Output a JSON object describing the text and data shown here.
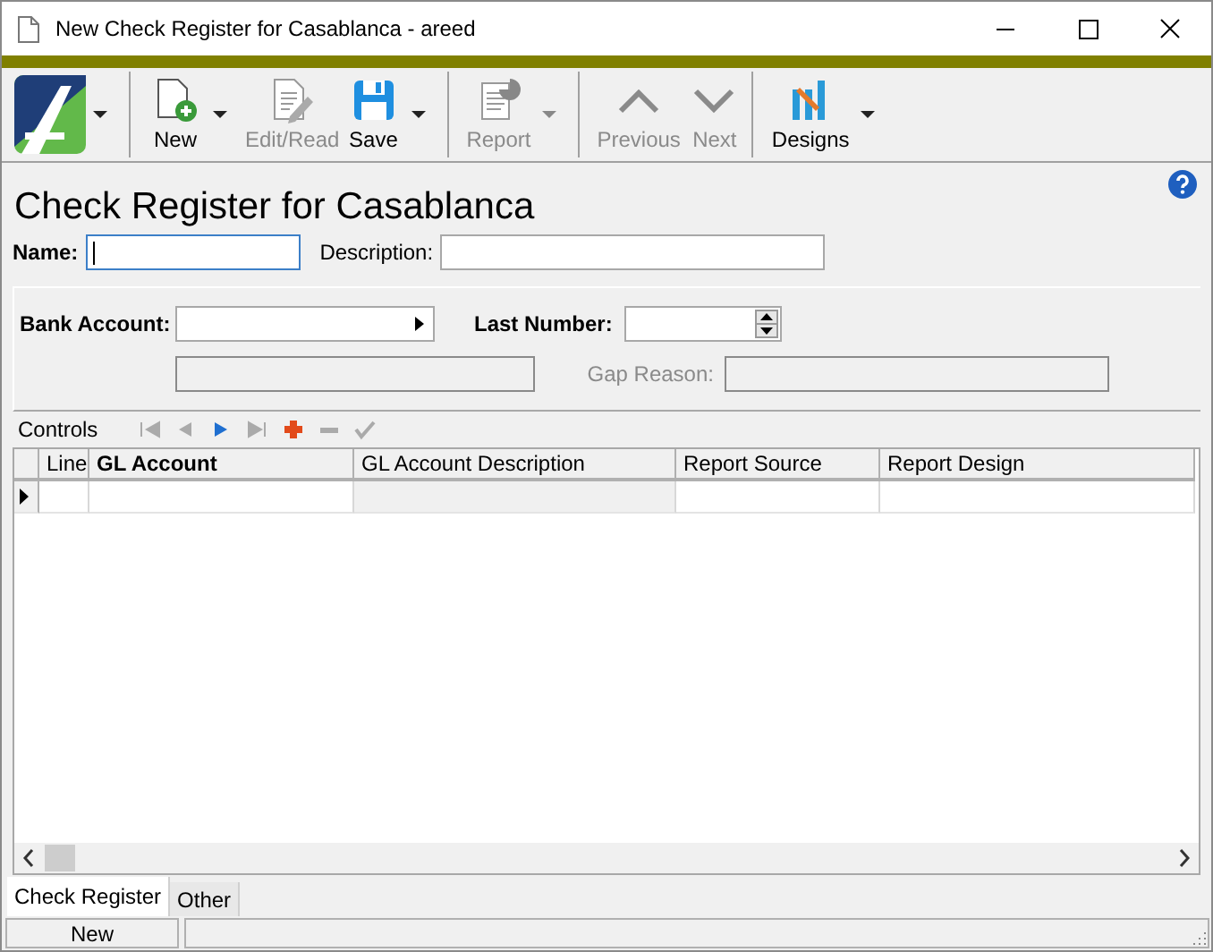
{
  "window": {
    "title": "New Check Register for Casablanca - areed"
  },
  "toolbar": [
    {
      "kind": "logo",
      "dropdown": true
    },
    {
      "kind": "new",
      "label": "New",
      "disabled": false,
      "dropdown": true
    },
    {
      "kind": "edit",
      "label": "Edit/Read",
      "disabled": true,
      "dropdown": false
    },
    {
      "kind": "save",
      "label": "Save",
      "disabled": false,
      "dropdown": true
    },
    {
      "kind": "report",
      "label": "Report",
      "disabled": true,
      "dropdown": true
    },
    {
      "kind": "previous",
      "label": "Previous",
      "disabled": true,
      "dropdown": false
    },
    {
      "kind": "next",
      "label": "Next",
      "disabled": true,
      "dropdown": false
    },
    {
      "kind": "designs",
      "label": "Designs",
      "disabled": false,
      "dropdown": true
    }
  ],
  "heading": "Check Register for Casablanca",
  "name_field": {
    "label": "Name:",
    "focused": true
  },
  "description_field": {
    "label": "Description:"
  },
  "bank_account": {
    "label": "Bank Account:"
  },
  "last_number": {
    "label": "Last Number:"
  },
  "gap_reason": {
    "label": "Gap Reason:",
    "disabled": true
  },
  "navigator": {
    "label": "Controls",
    "buttons": [
      {
        "kind": "first",
        "disabled": true
      },
      {
        "kind": "prev",
        "disabled": true
      },
      {
        "kind": "next",
        "disabled": false
      },
      {
        "kind": "last",
        "disabled": true
      },
      {
        "kind": "add",
        "disabled": false
      },
      {
        "kind": "remove",
        "disabled": true
      },
      {
        "kind": "confirm",
        "disabled": true
      }
    ]
  },
  "table": {
    "columns": [
      {
        "label": "Line",
        "required": false,
        "readonly": false
      },
      {
        "label": "GL Account",
        "required": true,
        "readonly": false
      },
      {
        "label": "GL Account Description",
        "required": false,
        "readonly": true
      },
      {
        "label": "Report Source",
        "required": false,
        "readonly": false
      },
      {
        "label": "Report Design",
        "required": false,
        "readonly": false
      }
    ],
    "rows": [
      {
        "current": true
      }
    ]
  },
  "tabs": [
    {
      "label": "Check Register",
      "selected": true
    },
    {
      "label": "Other",
      "selected": false
    }
  ],
  "status_bar": {
    "mode": "New"
  }
}
